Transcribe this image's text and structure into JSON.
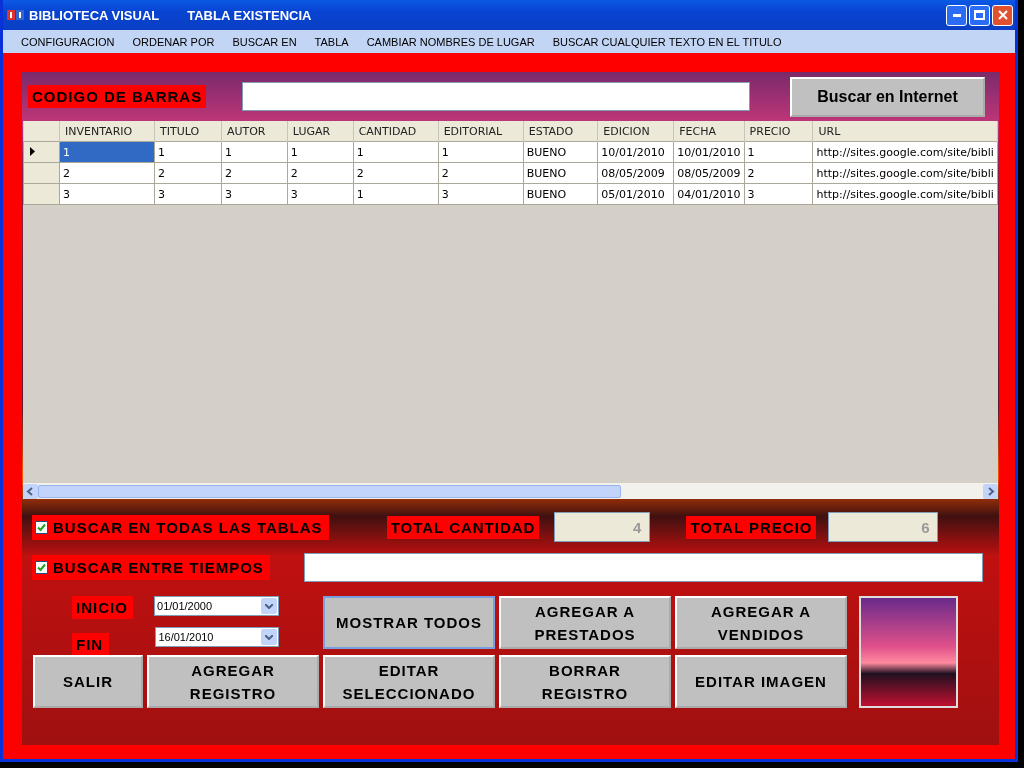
{
  "window": {
    "title": "BIBLIOTECA VISUAL",
    "subtitle": "TABLA EXISTENCIA"
  },
  "menu": [
    "CONFIGURACION",
    "ORDENAR POR",
    "BUSCAR EN",
    "TABLA",
    "CAMBIAR NOMBRES DE LUGAR",
    "BUSCAR CUALQUIER TEXTO EN EL TITULO"
  ],
  "barcode": {
    "label": "CODIGO DE BARRAS",
    "button": "Buscar en Internet"
  },
  "table": {
    "columns": [
      "INVENTARIO",
      "TITULO",
      "AUTOR",
      "LUGAR",
      "CANTIDAD",
      "EDITORIAL",
      "ESTADO",
      "EDICION",
      "FECHA",
      "PRECIO",
      "URL"
    ],
    "rows": [
      {
        "selected": true,
        "cells": [
          "1",
          "1",
          "1",
          "1",
          "1",
          "1",
          "BUENO",
          "10/01/2010",
          "10/01/2010",
          "1",
          "http://sites.google.com/site/bibli"
        ]
      },
      {
        "selected": false,
        "cells": [
          "2",
          "2",
          "2",
          "2",
          "2",
          "2",
          "BUENO",
          "08/05/2009",
          "08/05/2009",
          "2",
          "http://sites.google.com/site/bibli"
        ]
      },
      {
        "selected": false,
        "cells": [
          "3",
          "3",
          "3",
          "3",
          "1",
          "3",
          "BUENO",
          "05/01/2010",
          "04/01/2010",
          "3",
          "http://sites.google.com/site/bibli"
        ]
      }
    ]
  },
  "options": [
    {
      "label": "BUSCAR EN TODAS LAS TABLAS",
      "checked": true
    },
    {
      "label": "BUSCAR ENTRE TIEMPOS",
      "checked": true
    }
  ],
  "totals": [
    {
      "label": "TOTAL CANTIDAD",
      "value": "4"
    },
    {
      "label": "TOTAL PRECIO",
      "value": "6"
    }
  ],
  "dates": [
    {
      "label": "INICIO",
      "value": "01/01/2000"
    },
    {
      "label": "FIN",
      "value": "16/01/2010"
    }
  ],
  "buttons_top": [
    "MOSTRAR TODOS",
    "AGREGAR A PRESTADOS",
    "AGREGAR A VENDIDOS"
  ],
  "exit_button": "SALIR",
  "buttons_bottom": [
    "AGREGAR REGISTRO",
    "EDITAR SELECCIONADO",
    "BORRAR REGISTRO",
    "EDITAR IMAGEN"
  ]
}
